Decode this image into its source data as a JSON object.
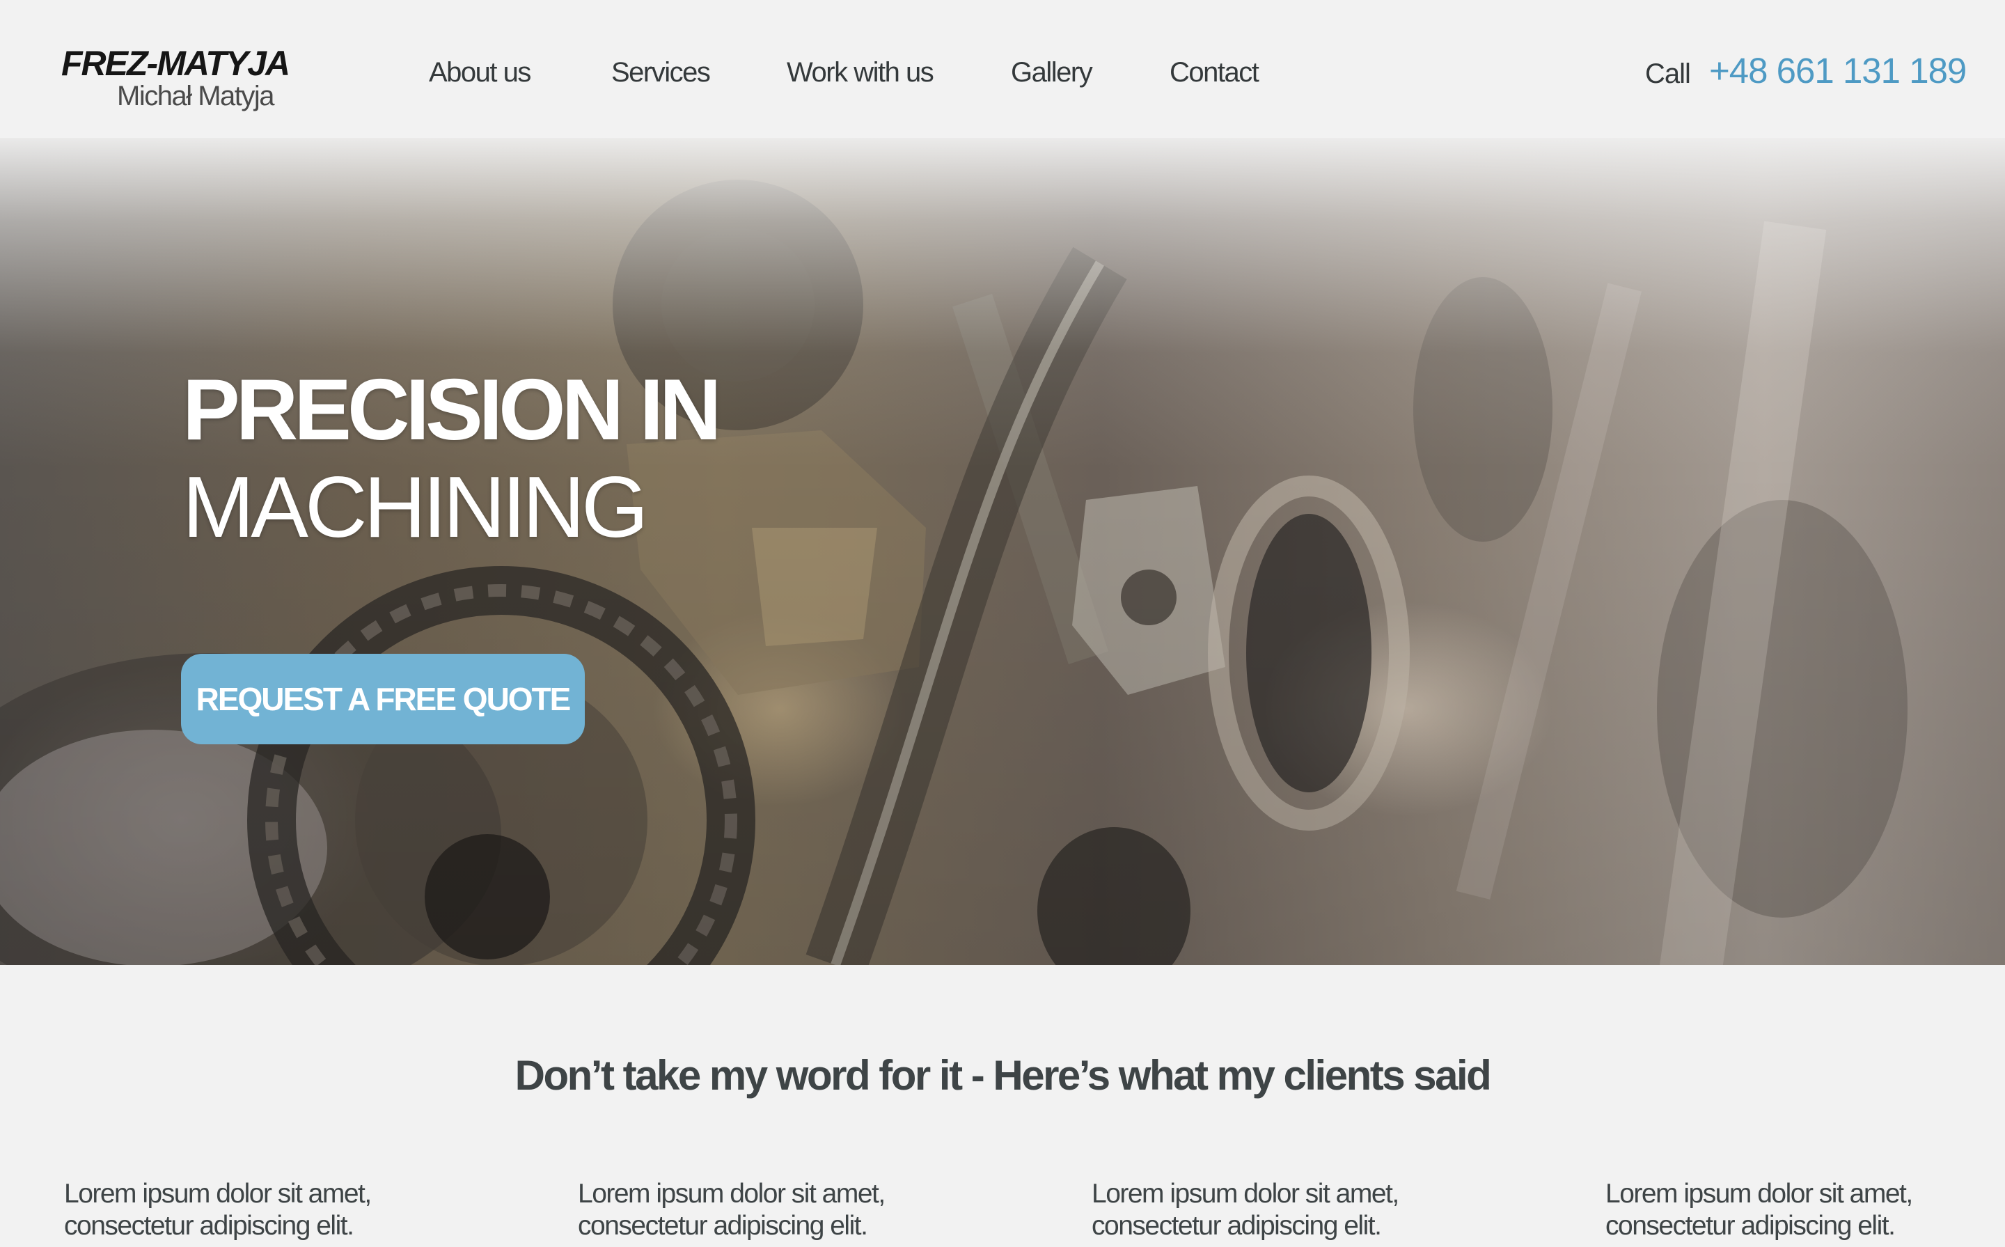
{
  "logo": {
    "title": "FREZ-MATYJA",
    "subtitle": "Michał Matyja"
  },
  "nav": {
    "items": [
      "About us",
      "Services",
      "Work with us",
      "Gallery",
      "Contact"
    ]
  },
  "contact": {
    "call_label": "Call",
    "phone": "+48 661 131 189"
  },
  "hero": {
    "title_line1": "PRECISION IN",
    "title_line2": "MACHINING",
    "cta_label": "REQUEST A FREE QUOTE"
  },
  "testimonials": {
    "heading": "Don’t take my word for it - Here’s what my clients said",
    "items": [
      {
        "line1": "Lorem ipsum dolor sit amet,",
        "line2": "consectetur adipiscing elit."
      },
      {
        "line1": "Lorem ipsum dolor sit amet,",
        "line2": "consectetur adipiscing elit."
      },
      {
        "line1": "Lorem ipsum dolor sit amet,",
        "line2": "consectetur adipiscing elit."
      },
      {
        "line1": "Lorem ipsum dolor sit amet,",
        "line2": "consectetur adipiscing elit."
      }
    ]
  },
  "colors": {
    "accent": "#4e9ac4",
    "button": "#72b3d4",
    "background": "#f2f2f2",
    "text": "#3e4446"
  }
}
